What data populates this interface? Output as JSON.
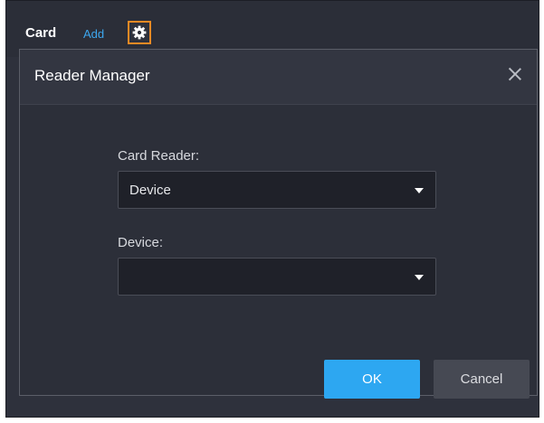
{
  "toolbar": {
    "title": "Card",
    "add_label": "Add",
    "settings_icon": "gear-icon"
  },
  "dialog": {
    "title": "Reader Manager",
    "close_icon": "close-icon",
    "fields": {
      "card_reader_label": "Card Reader:",
      "card_reader_value": "Device",
      "device_label": "Device:",
      "device_value": ""
    },
    "buttons": {
      "ok": "OK",
      "cancel": "Cancel"
    }
  },
  "colors": {
    "accent": "#2da7f1",
    "link": "#3da7ee",
    "highlight_border": "#f08a24",
    "panel_bg": "#2e313c"
  }
}
